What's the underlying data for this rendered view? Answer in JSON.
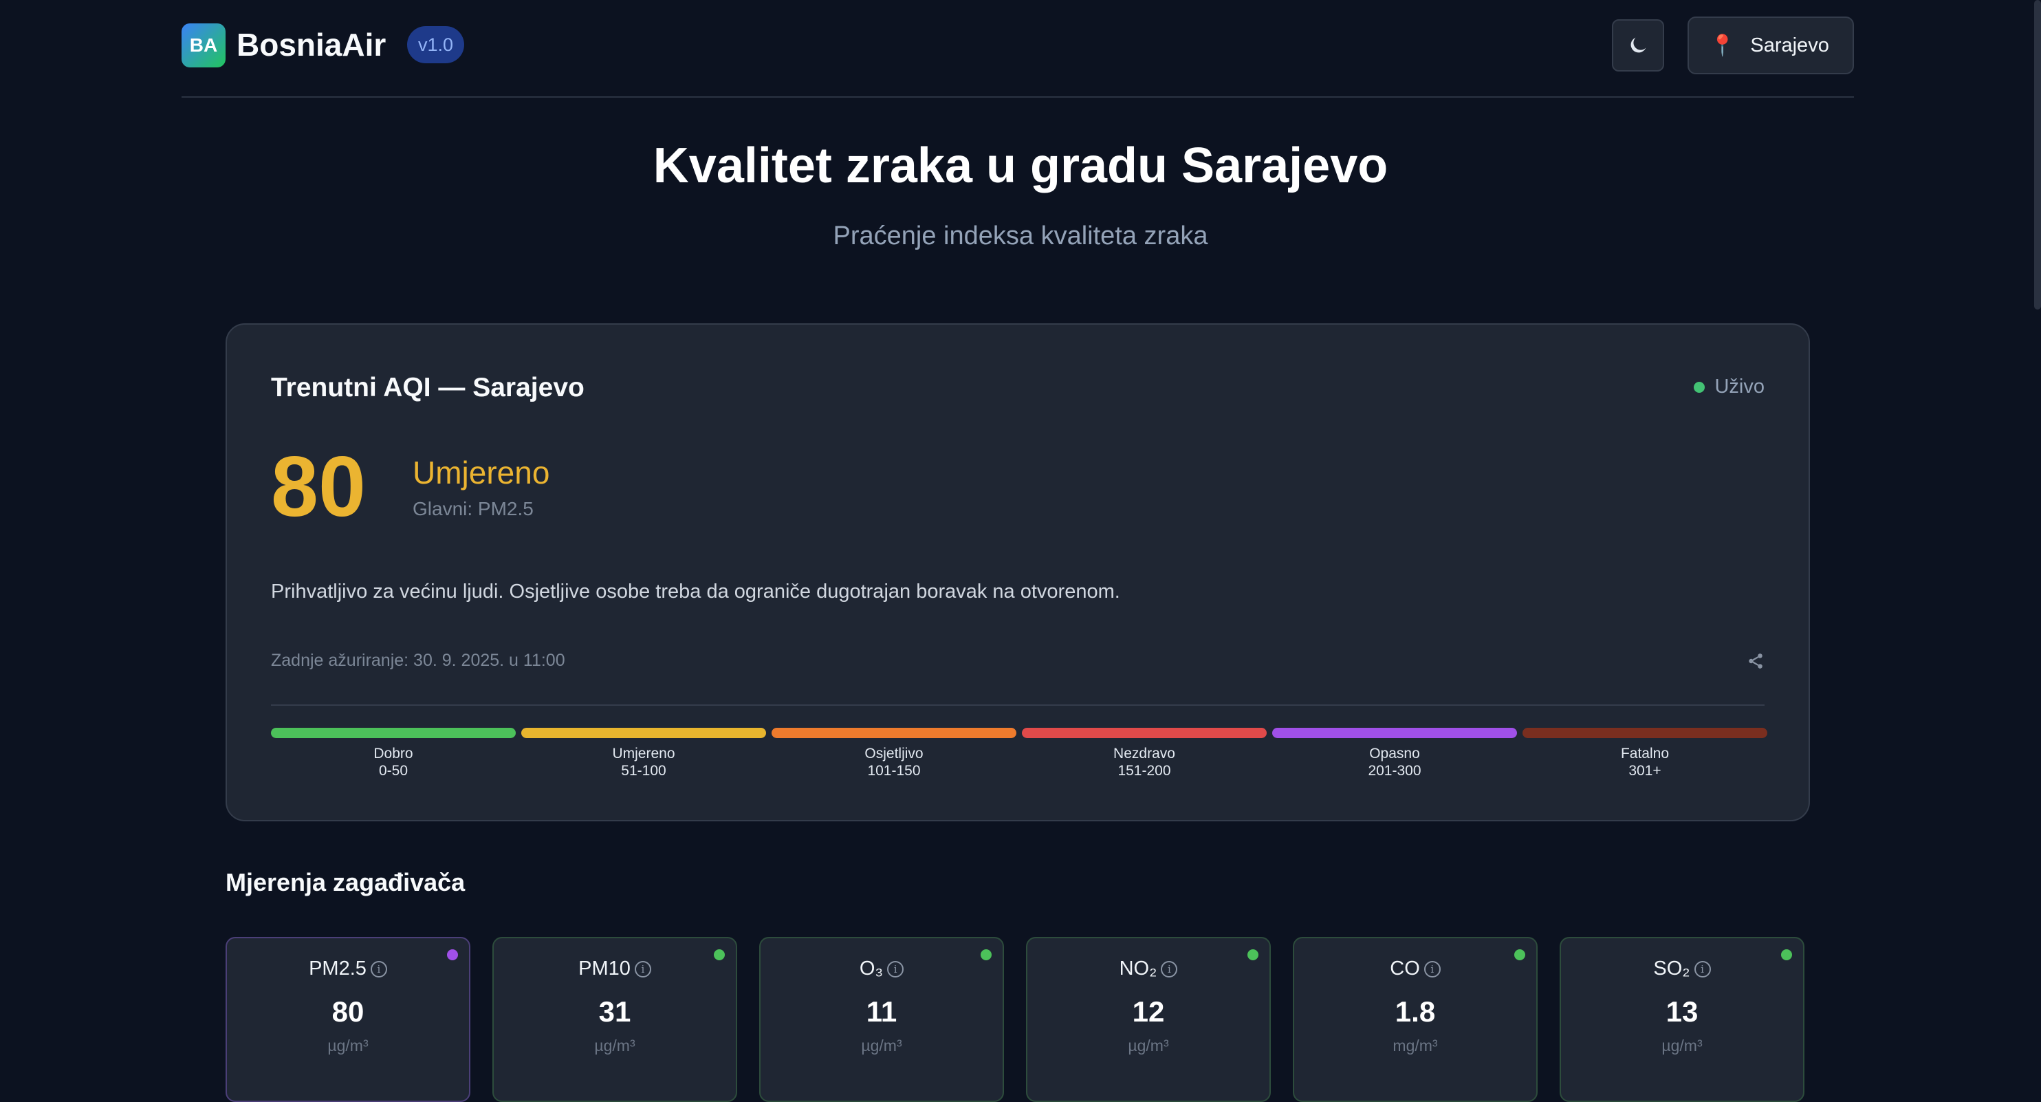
{
  "header": {
    "logo_text": "BA",
    "app_name": "BosniaAir",
    "version": "v1.0",
    "location_label": "Sarajevo"
  },
  "hero": {
    "title": "Kvalitet zraka u gradu Sarajevo",
    "subtitle": "Praćenje indeksa kvaliteta zraka"
  },
  "aqi_card": {
    "title": "Trenutni AQI — Sarajevo",
    "live_label": "Uživo",
    "aqi_value": "80",
    "category": "Umjereno",
    "main_pollutant": "Glavni: PM2.5",
    "description": "Prihvatljivo za većinu ljudi. Osjetljive osobe treba da ograniče dugotrajan boravak na otvorenom.",
    "last_update": "Zadnje ažuriranje: 30. 9. 2025. u 11:00",
    "scale": [
      {
        "label": "Dobro",
        "range": "0-50",
        "color": "#4cc15a"
      },
      {
        "label": "Umjereno",
        "range": "51-100",
        "color": "#e8b52e"
      },
      {
        "label": "Osjetljivo",
        "range": "101-150",
        "color": "#ee7b2d"
      },
      {
        "label": "Nezdravo",
        "range": "151-200",
        "color": "#e04a4a"
      },
      {
        "label": "Opasno",
        "range": "201-300",
        "color": "#a050e8"
      },
      {
        "label": "Fatalno",
        "range": "301+",
        "color": "#7a2e1f"
      }
    ]
  },
  "pollutants": {
    "section_title": "Mjerenja zagađivača",
    "items": [
      {
        "name": "PM2.5",
        "value": "80",
        "unit": "µg/m³",
        "status_color": "#a050e8"
      },
      {
        "name": "PM10",
        "value": "31",
        "unit": "µg/m³",
        "status_color": "#4cc15a"
      },
      {
        "name": "O₃",
        "value": "11",
        "unit": "µg/m³",
        "status_color": "#4cc15a"
      },
      {
        "name": "NO₂",
        "value": "12",
        "unit": "µg/m³",
        "status_color": "#4cc15a"
      },
      {
        "name": "CO",
        "value": "1.8",
        "unit": "mg/m³",
        "status_color": "#4cc15a"
      },
      {
        "name": "SO₂",
        "value": "13",
        "unit": "µg/m³",
        "status_color": "#4cc15a"
      }
    ]
  }
}
